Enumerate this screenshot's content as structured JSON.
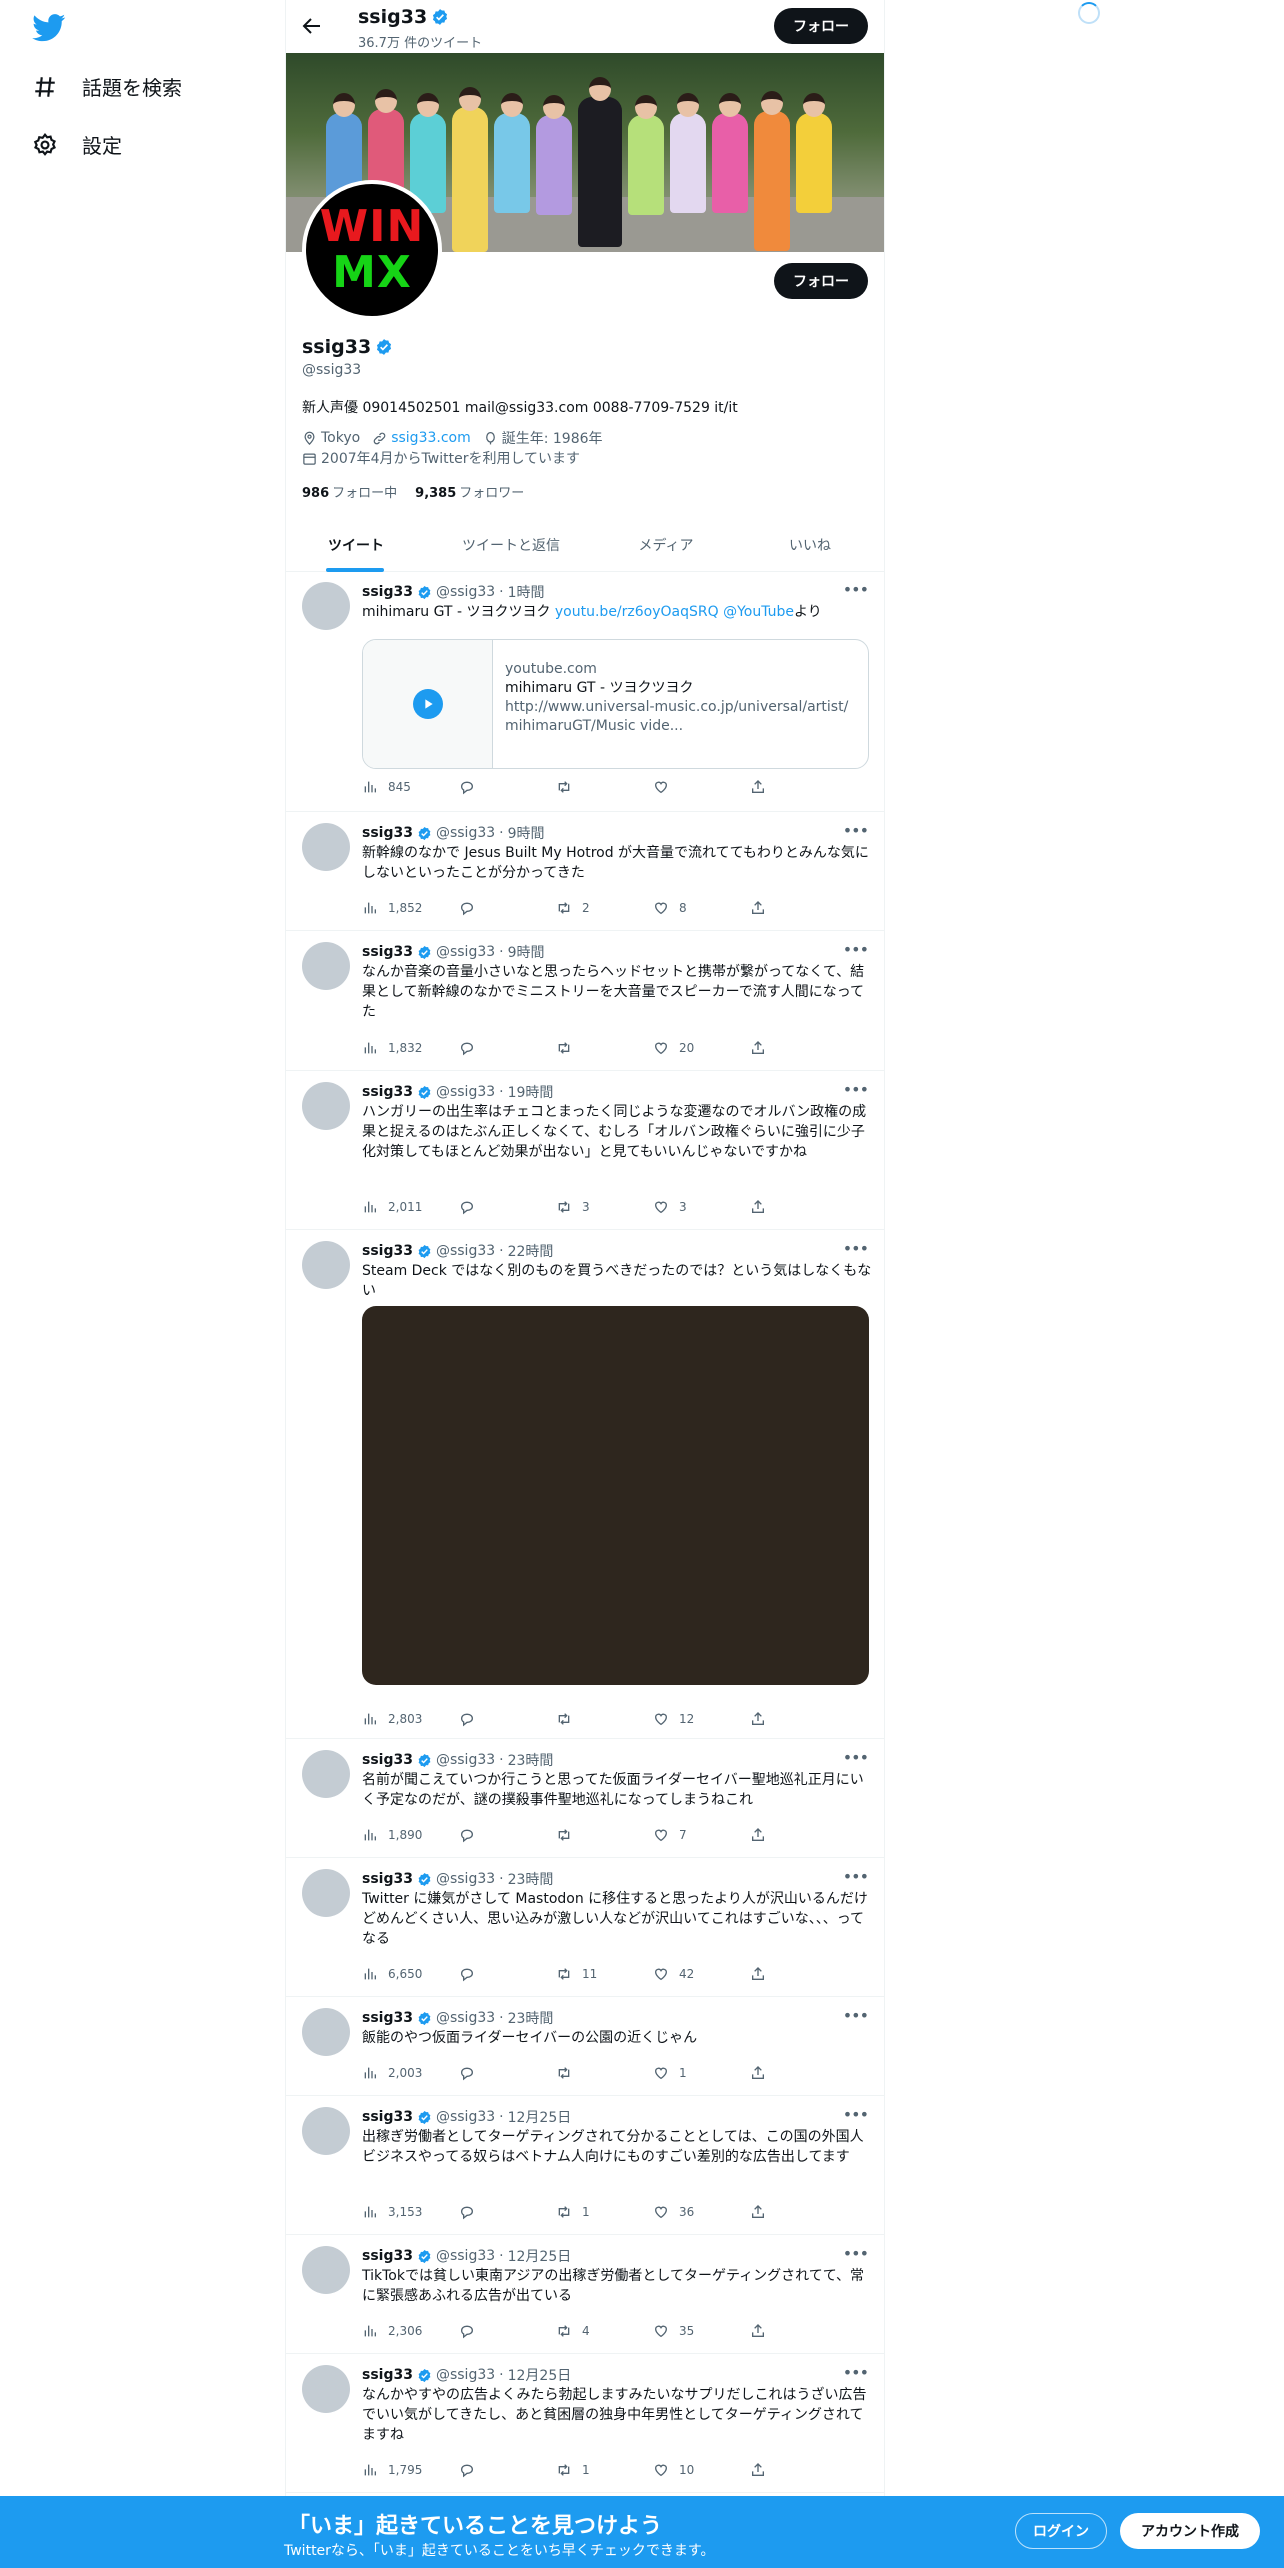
{
  "nav": {
    "explore_label": "話題を検索",
    "settings_label": "設定"
  },
  "header": {
    "name": "ssig33",
    "tweet_count": "36.7万 件のツイート",
    "follow_label": "フォロー"
  },
  "profile": {
    "avatar_text_line1": "WIN",
    "avatar_text_line2": "MX",
    "name": "ssig33",
    "handle": "@ssig33",
    "bio": "新人声優 09014502501 mail@ssig33.com 0088-7709-7529 it/it",
    "location": "Tokyo",
    "website": "ssig33.com",
    "birth": "誕生年: 1986年",
    "joined": "2007年4月からTwitterを利用しています",
    "following_count": "986",
    "following_label": "フォロー中",
    "followers_count": "9,385",
    "followers_label": "フォロワー",
    "follow_label": "フォロー"
  },
  "tabs": [
    {
      "label": "ツイート"
    },
    {
      "label": "ツイートと返信"
    },
    {
      "label": "メディア"
    },
    {
      "label": "いいね"
    }
  ],
  "tweets": [
    {
      "name": "ssig33",
      "handle": "@ssig33",
      "time": "1時間",
      "text_pre": "mihimaru GT - ツヨクツヨク ",
      "link": "youtu.be/rz6oyOaqSRQ",
      "mention": "@YouTube",
      "text_post": "より",
      "views": "845",
      "replies": "",
      "retweets": "",
      "likes": ""
    },
    {
      "name": "ssig33",
      "handle": "@ssig33",
      "time": "9時間",
      "text": "新幹線のなかで Jesus Built My Hotrod が大音量で流れててもわりとみんな気にしないといったことが分かってきた",
      "views": "1,852",
      "replies": "",
      "retweets": "2",
      "likes": "8"
    },
    {
      "name": "ssig33",
      "handle": "@ssig33",
      "time": "9時間",
      "text": "なんか音楽の音量小さいなと思ったらヘッドセットと携帯が繋がってなくて、結果として新幹線のなかでミニストリーを大音量でスピーカーで流す人間になってた",
      "views": "1,832",
      "replies": "",
      "retweets": "",
      "likes": "20"
    },
    {
      "name": "ssig33",
      "handle": "@ssig33",
      "time": "19時間",
      "text": "ハンガリーの出生率はチェコとまったく同じような変遷なのでオルバン政権の成果と捉えるのはたぶん正しくなくて、むしろ「オルバン政権ぐらいに強引に少子化対策してもほとんど効果が出ない」と見てもいいんじゃないですかね",
      "views": "2,011",
      "replies": "",
      "retweets": "3",
      "likes": "3"
    },
    {
      "name": "ssig33",
      "handle": "@ssig33",
      "time": "22時間",
      "text": "Steam Deck ではなく別のものを買うべきだったのでは？という気はしなくもない",
      "views": "2,803",
      "replies": "",
      "retweets": "",
      "likes": "12"
    },
    {
      "name": "ssig33",
      "handle": "@ssig33",
      "time": "23時間",
      "text": "名前が聞こえていつか行こうと思ってた仮面ライダーセイバー聖地巡礼正月にいく予定なのだが、謎の撲殺事件聖地巡礼になってしまうねこれ",
      "views": "1,890",
      "replies": "",
      "retweets": "",
      "likes": "7"
    },
    {
      "name": "ssig33",
      "handle": "@ssig33",
      "time": "23時間",
      "text": "Twitter に嫌気がさして Mastodon に移住すると思ったより人が沢山いるんだけどめんどくさい人、思い込みが激しい人などが沢山いてこれはすごいな、、、ってなる",
      "views": "6,650",
      "replies": "",
      "retweets": "11",
      "likes": "42"
    },
    {
      "name": "ssig33",
      "handle": "@ssig33",
      "time": "23時間",
      "text": "飯能のやつ仮面ライダーセイバーの公園の近くじゃん",
      "views": "2,003",
      "replies": "",
      "retweets": "",
      "likes": "1"
    },
    {
      "name": "ssig33",
      "handle": "@ssig33",
      "time": "12月25日",
      "text": "出稼ぎ労働者としてターゲティングされて分かることとしては、この国の外国人ビジネスやってる奴らはベトナム人向けにものすごい差別的な広告出してます",
      "views": "3,153",
      "replies": "",
      "retweets": "1",
      "likes": "36"
    },
    {
      "name": "ssig33",
      "handle": "@ssig33",
      "time": "12月25日",
      "text": "TikTokでは貧しい東南アジアの出稼ぎ労働者としてターゲティングされてて、常に緊張感あふれる広告が出ている",
      "views": "2,306",
      "replies": "",
      "retweets": "4",
      "likes": "35"
    },
    {
      "name": "ssig33",
      "handle": "@ssig33",
      "time": "12月25日",
      "text": "なんかやすやの広告よくみたら勃起しますみたいなサプリだしこれはうざい広告でいい気がしてきたし、あと貧困層の独身中年男性としてターゲティングされてますね",
      "views": "1,795",
      "replies": "",
      "retweets": "1",
      "likes": "10"
    }
  ],
  "card": {
    "domain": "youtube.com",
    "title": "mihimaru GT - ツヨクツヨク",
    "desc": "http://www.universal-music.co.jp/universal/artist/mihimaruGT/Music vide..."
  },
  "bottombar": {
    "title": "「いま」起きていることを見つけよう",
    "subtitle": "Twitterなら、「いま」起きていることをいち早くチェックできます。",
    "login_label": "ログイン",
    "signup_label": "アカウント作成"
  },
  "colors": {
    "accent": "#1d9bf0",
    "text": "#0f1419",
    "muted": "#536471"
  }
}
